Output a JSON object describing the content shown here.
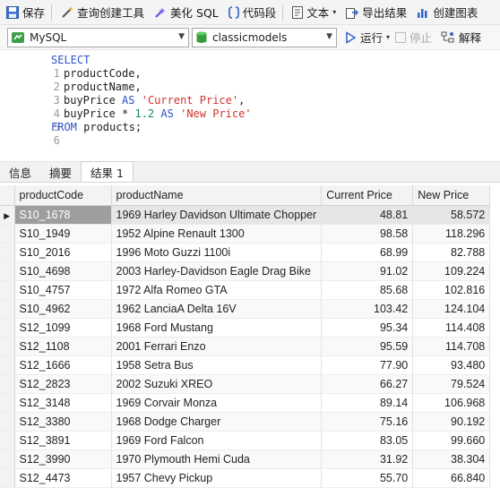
{
  "toolbar": {
    "save": "保存",
    "query_builder": "查询创建工具",
    "beautify_sql": "美化 SQL",
    "code_snippet": "代码段",
    "text": "文本",
    "export_result": "导出结果",
    "create_chart": "创建图表"
  },
  "connection": {
    "type": "MySQL",
    "database": "classicmodels",
    "run": "运行",
    "stop": "停止",
    "explain": "解释"
  },
  "editor": {
    "line_numbers": [
      "1",
      "2",
      "3",
      "4",
      "5",
      "6"
    ],
    "kw_select": "SELECT",
    "col_product_code": "productCode,",
    "col_product_name": "productName,",
    "col_buyprice": "buyPrice ",
    "kw_as": "AS",
    "str_current_price": "'Current Price'",
    "comma": ",",
    "col_buyprice2": "buyPrice * ",
    "num_multiplier": "1.2",
    "kw_as2": "AS",
    "str_new_price": "'New Price'",
    "kw_from": "FROM",
    "table_name": " products;"
  },
  "tabs": {
    "info": "信息",
    "summary": "摘要",
    "result1": "结果 1"
  },
  "grid": {
    "columns": [
      "productCode",
      "productName",
      "Current Price",
      "New Price"
    ],
    "selected_row": 0,
    "rows": [
      [
        "S10_1678",
        "1969 Harley Davidson Ultimate Chopper",
        "48.81",
        "58.572"
      ],
      [
        "S10_1949",
        "1952 Alpine Renault 1300",
        "98.58",
        "118.296"
      ],
      [
        "S10_2016",
        "1996 Moto Guzzi 1100i",
        "68.99",
        "82.788"
      ],
      [
        "S10_4698",
        "2003 Harley-Davidson Eagle Drag Bike",
        "91.02",
        "109.224"
      ],
      [
        "S10_4757",
        "1972 Alfa Romeo GTA",
        "85.68",
        "102.816"
      ],
      [
        "S10_4962",
        "1962 LanciaA Delta 16V",
        "103.42",
        "124.104"
      ],
      [
        "S12_1099",
        "1968 Ford Mustang",
        "95.34",
        "114.408"
      ],
      [
        "S12_1108",
        "2001 Ferrari Enzo",
        "95.59",
        "114.708"
      ],
      [
        "S12_1666",
        "1958 Setra Bus",
        "77.90",
        "93.480"
      ],
      [
        "S12_2823",
        "2002 Suzuki XREO",
        "66.27",
        "79.524"
      ],
      [
        "S12_3148",
        "1969 Corvair Monza",
        "89.14",
        "106.968"
      ],
      [
        "S12_3380",
        "1968 Dodge Charger",
        "75.16",
        "90.192"
      ],
      [
        "S12_3891",
        "1969 Ford Falcon",
        "83.05",
        "99.660"
      ],
      [
        "S12_3990",
        "1970 Plymouth Hemi Cuda",
        "31.92",
        "38.304"
      ],
      [
        "S12_4473",
        "1957 Chevy Pickup",
        "55.70",
        "66.840"
      ]
    ]
  }
}
